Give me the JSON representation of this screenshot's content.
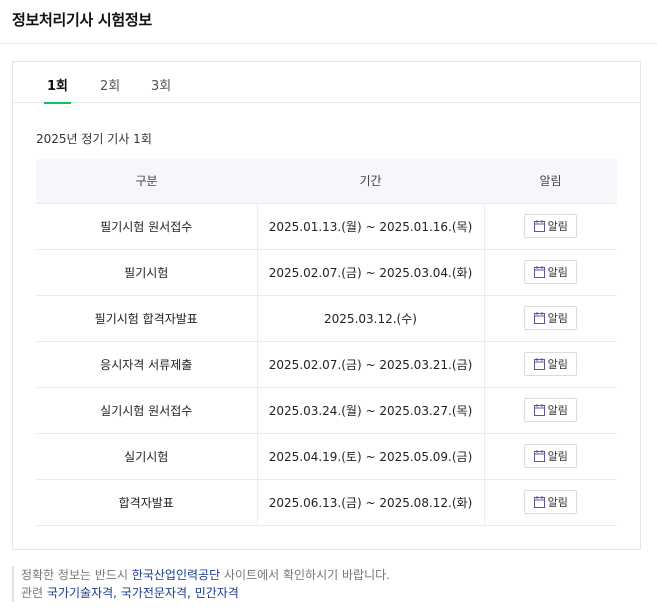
{
  "page": {
    "title": "정보처리기사 시험정보"
  },
  "tabs": [
    {
      "label": "1회",
      "active": true
    },
    {
      "label": "2회",
      "active": false
    },
    {
      "label": "3회",
      "active": false
    }
  ],
  "exam": {
    "subtitle": "2025년 정기 기사 1회"
  },
  "table": {
    "headers": {
      "category": "구분",
      "period": "기간",
      "alarm": "알림"
    },
    "rows": [
      {
        "category": "필기시험 원서접수",
        "period": "2025.01.13.(월) ~ 2025.01.16.(목)",
        "alarm": "알림"
      },
      {
        "category": "필기시험",
        "period": "2025.02.07.(금) ~ 2025.03.04.(화)",
        "alarm": "알림"
      },
      {
        "category": "필기시험 합격자발표",
        "period": "2025.03.12.(수)",
        "alarm": "알림"
      },
      {
        "category": "응시자격 서류제출",
        "period": "2025.02.07.(금) ~ 2025.03.21.(금)",
        "alarm": "알림"
      },
      {
        "category": "실기시험 원서접수",
        "period": "2025.03.24.(월) ~ 2025.03.27.(목)",
        "alarm": "알림"
      },
      {
        "category": "실기시험",
        "period": "2025.04.19.(토) ~ 2025.05.09.(금)",
        "alarm": "알림"
      },
      {
        "category": "합격자발표",
        "period": "2025.06.13.(금) ~ 2025.08.12.(화)",
        "alarm": "알림"
      }
    ]
  },
  "footer": {
    "notice_prefix": "정확한 정보는 반드시 ",
    "notice_link": "한국산업인력공단",
    "notice_suffix": " 사이트에서 확인하시기 바랍니다.",
    "related_prefix": "관련 ",
    "related_links": [
      "국가기술자격",
      "국가전문자격",
      "민간자격"
    ],
    "separator": ", "
  },
  "icons": {
    "alarm": "calendar-icon"
  },
  "colors": {
    "tab_active_underline": "#03c75a",
    "link": "#1a3d8f",
    "icon": "#6b4fa0"
  }
}
